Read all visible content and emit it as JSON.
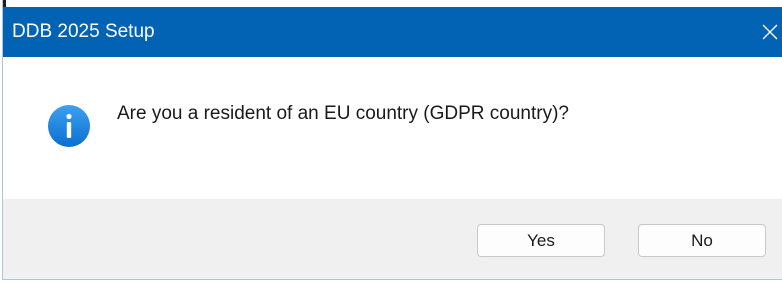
{
  "window": {
    "title": "DDB 2025 Setup",
    "close_icon": "close-icon",
    "accent_color": "#0263b5"
  },
  "message": {
    "icon": "info-icon",
    "text": "Are you a resident of an EU country (GDPR country)?"
  },
  "buttons": {
    "yes_label": "Yes",
    "no_label": "No"
  }
}
